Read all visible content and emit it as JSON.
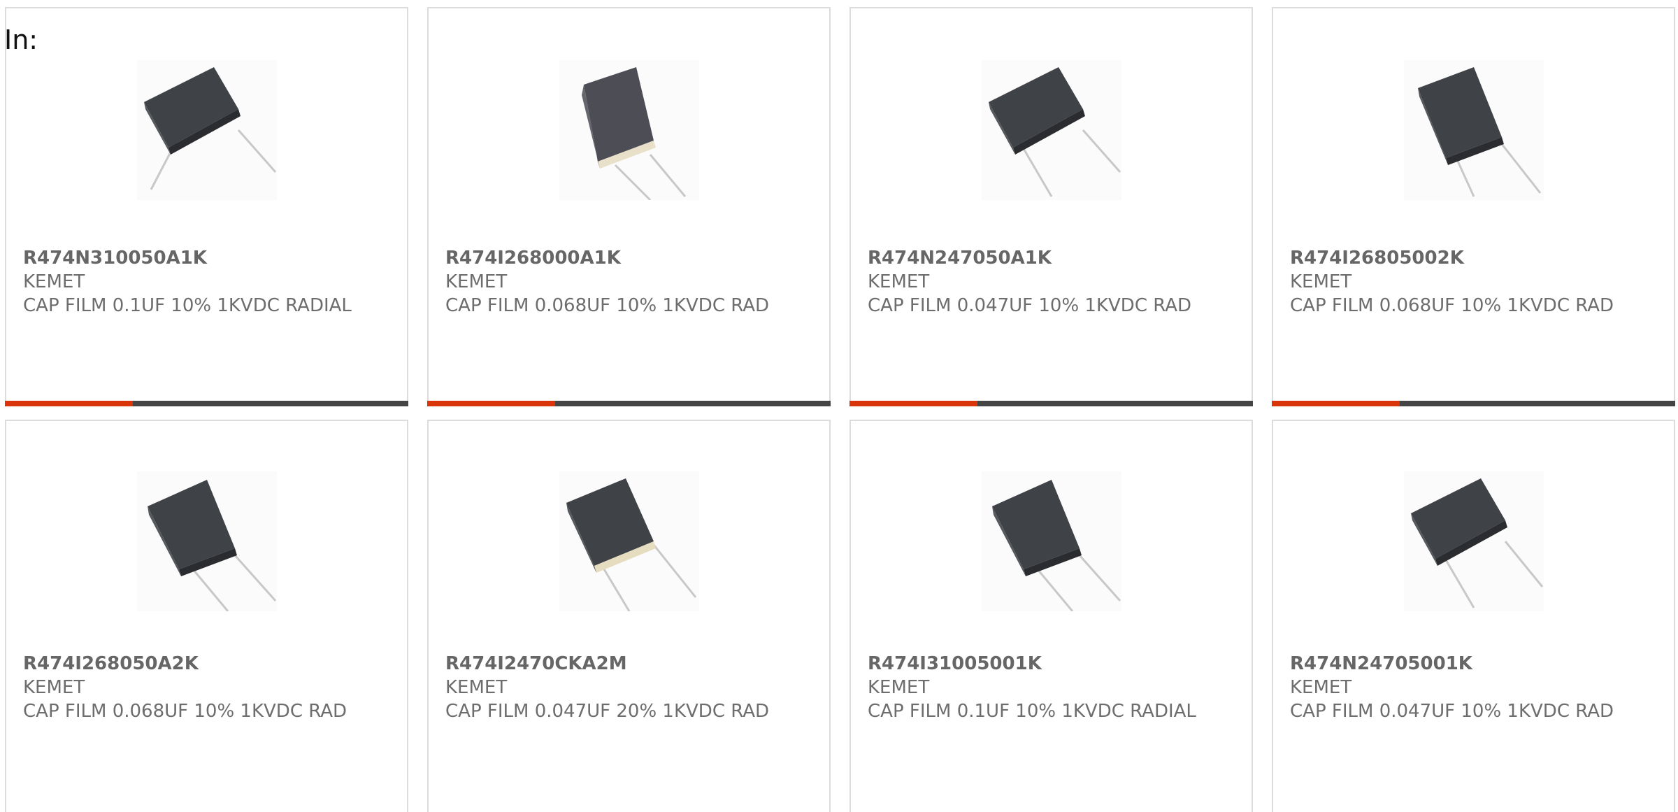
{
  "page": {
    "label": "In:"
  },
  "colors": {
    "accent": "#d9340a",
    "bar": "#444444",
    "text": "#6d6d6d",
    "border": "#dcdcdc"
  },
  "products": [
    {
      "part_number": "R474N310050A1K",
      "manufacturer": "KEMET",
      "description": "CAP FILM 0.1UF 10% 1KVDC RADIAL",
      "image_icon": "film-capacitor-icon"
    },
    {
      "part_number": "R474I268000A1K",
      "manufacturer": "KEMET",
      "description": "CAP FILM 0.068UF 10% 1KVDC RAD",
      "image_icon": "film-capacitor-icon"
    },
    {
      "part_number": "R474N247050A1K",
      "manufacturer": "KEMET",
      "description": "CAP FILM 0.047UF 10% 1KVDC RAD",
      "image_icon": "film-capacitor-icon"
    },
    {
      "part_number": "R474I26805002K",
      "manufacturer": "KEMET",
      "description": "CAP FILM 0.068UF 10% 1KVDC RAD",
      "image_icon": "film-capacitor-icon"
    },
    {
      "part_number": "R474I268050A2K",
      "manufacturer": "KEMET",
      "description": "CAP FILM 0.068UF 10% 1KVDC RAD",
      "image_icon": "film-capacitor-icon"
    },
    {
      "part_number": "R474I2470CKA2M",
      "manufacturer": "KEMET",
      "description": "CAP FILM 0.047UF 20% 1KVDC RAD",
      "image_icon": "film-capacitor-icon"
    },
    {
      "part_number": "R474I31005001K",
      "manufacturer": "KEMET",
      "description": "CAP FILM 0.1UF 10% 1KVDC RADIAL",
      "image_icon": "film-capacitor-icon"
    },
    {
      "part_number": "R474N24705001K",
      "manufacturer": "KEMET",
      "description": "CAP FILM 0.047UF 10% 1KVDC RAD",
      "image_icon": "film-capacitor-icon"
    }
  ]
}
